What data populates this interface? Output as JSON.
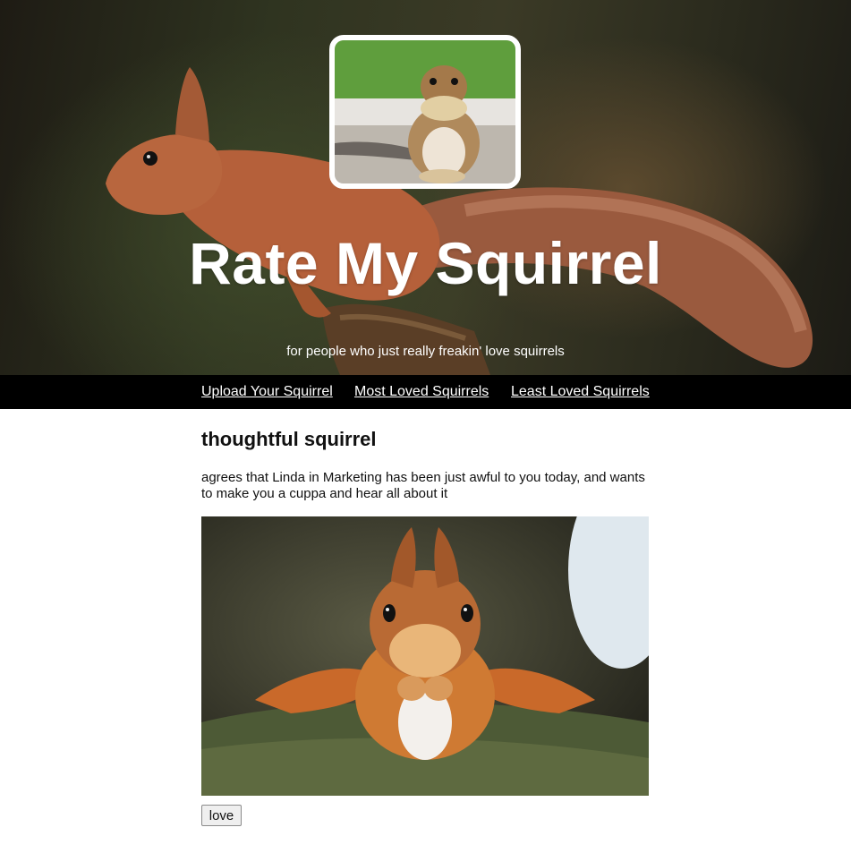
{
  "header": {
    "title": "Rate My Squirrel",
    "tagline": "for people who just really freakin' love squirrels"
  },
  "nav": {
    "items": [
      {
        "label": "Upload Your Squirrel"
      },
      {
        "label": "Most Loved Squirrels"
      },
      {
        "label": "Least Loved Squirrels"
      }
    ]
  },
  "post": {
    "title": "thoughtful squirrel",
    "description": "agrees that Linda in Marketing has been just awful to you today, and wants to make you a cuppa and hear all about it",
    "love_label": "love"
  },
  "colors": {
    "nav_background": "#000000",
    "title_text": "#ffffff",
    "squirrel_fur": "#b5603a"
  },
  "icons": {
    "logo": "chipmunk-photo",
    "hero_image": "red-squirrel-photo",
    "post_image": "squirrel-photo"
  }
}
